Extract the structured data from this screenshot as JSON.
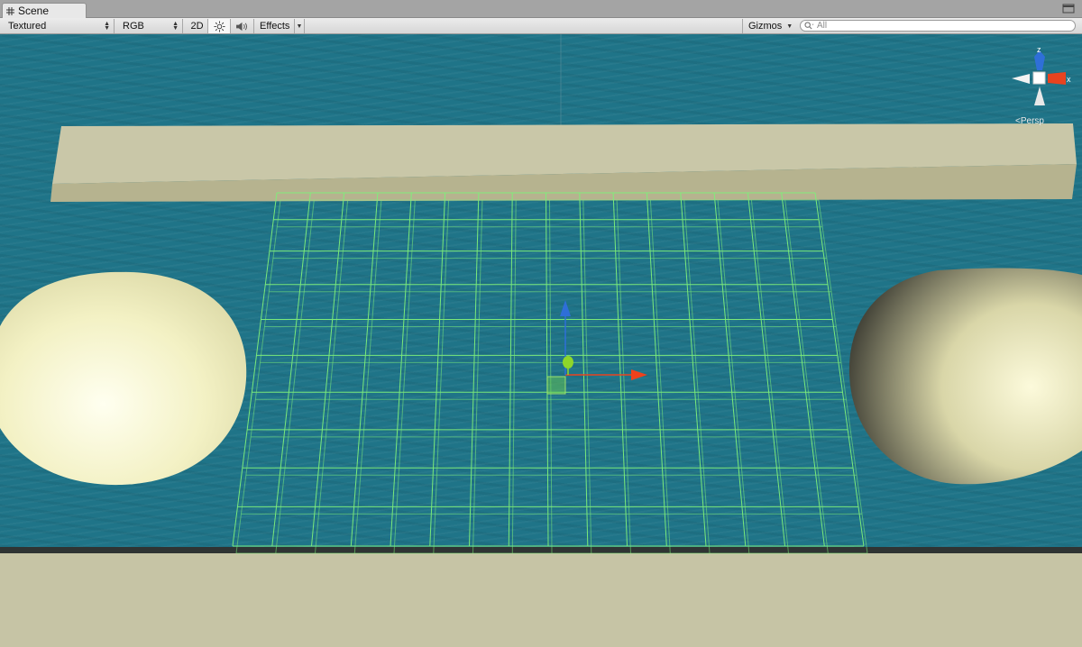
{
  "tab": {
    "title": "Scene",
    "icon": "scene-grid-icon"
  },
  "toolbar": {
    "draw_mode": "Textured",
    "render_mode": "RGB",
    "mode_2d_label": "2D",
    "lighting_icon": "sun-icon",
    "audio_icon": "speaker-icon",
    "effects_label": "Effects",
    "gizmos_label": "Gizmos",
    "search_placeholder": "All"
  },
  "gizmo": {
    "axis_z": "z",
    "axis_x": "x",
    "projection_label": "Persp"
  },
  "colors": {
    "water": "#1f7488",
    "wall": "#c6c4a5",
    "sphere": "#f2f0c6",
    "wireframe": "#7ff07a",
    "axis_x": "#e8431f",
    "axis_y": "#8fd62a",
    "axis_z": "#2e6fd8"
  }
}
